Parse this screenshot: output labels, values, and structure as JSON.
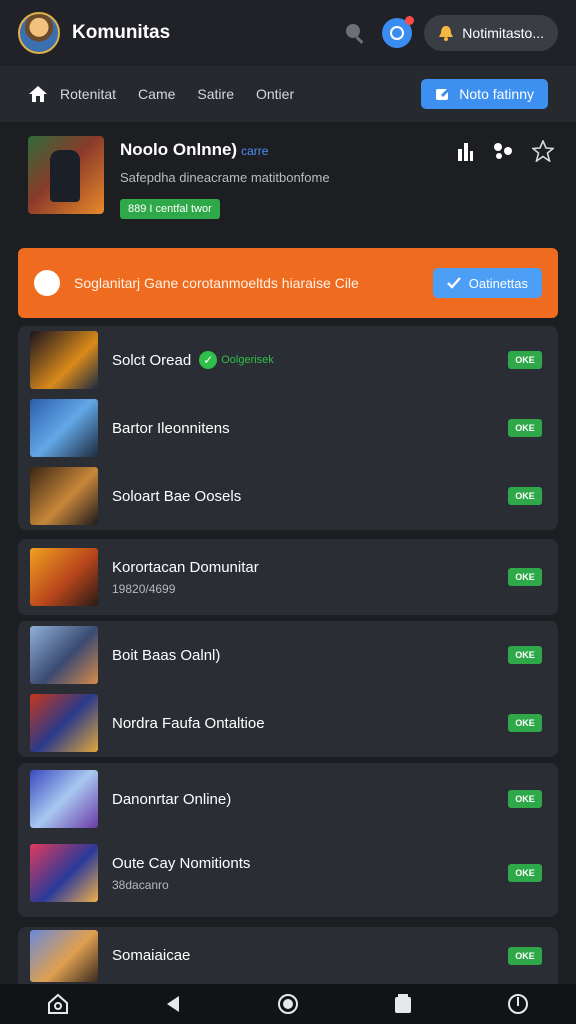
{
  "app": {
    "title": "Komunitas"
  },
  "topbar": {
    "notification_label": "Notimitasto..."
  },
  "nav": {
    "items": [
      "Rotenitat",
      "Came",
      "Satire",
      "Ontier"
    ],
    "cta_label": "Noto fatinny"
  },
  "featured": {
    "title": "Noolo Onlnne)",
    "tag": "carre",
    "subtitle": "Safepdha dineacrame matitbonfome",
    "badge": "889 I centfal twor"
  },
  "banner": {
    "text": "Soglanitarj Gane corotanmoeltds hiaraise Cile",
    "button_label": "Oatinettas"
  },
  "pill_label": "OKE",
  "groups": [
    {
      "rows": [
        {
          "title": "Solct Oread",
          "verified": "Oolgerisek",
          "sub": ""
        },
        {
          "title": "Bartor Ileonnitens",
          "sub": ""
        },
        {
          "title": "Soloart Bae Oosels",
          "sub": ""
        }
      ]
    },
    {
      "rows": [
        {
          "title": "Korortacan Domunitar",
          "sub": "19820/4699"
        }
      ]
    },
    {
      "rows": [
        {
          "title": "Boit Baas Oalnl)",
          "sub": ""
        },
        {
          "title": "Nordra Faufa Ontaltioe",
          "sub": ""
        }
      ]
    },
    {
      "rows": [
        {
          "title": "Danonrtar Online)",
          "sub": ""
        },
        {
          "title": "Oute Cay Nomitionts",
          "sub": "38dacanro"
        }
      ]
    },
    {
      "rows": [
        {
          "title": "Somaiaicae",
          "sub": ""
        }
      ]
    }
  ],
  "colors": {
    "accent_blue": "#3d8ff0",
    "banner_orange": "#ef6b1f",
    "badge_green": "#2fa84a",
    "background": "#1c1e22"
  },
  "icons": [
    "search-icon",
    "notification-icon",
    "bell-icon",
    "home-icon",
    "heart-icon",
    "star-icon",
    "bar-chart-icon",
    "settings-icon",
    "check-icon",
    "back-icon",
    "circle-home-icon",
    "square-icon",
    "power-icon"
  ]
}
